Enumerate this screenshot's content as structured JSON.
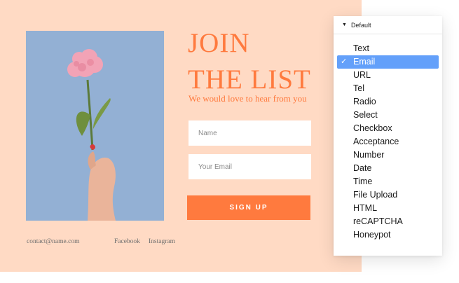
{
  "hero": {
    "title_line1": "JOIN",
    "title_line2": "THE LIST",
    "subtitle": "We would love to hear from you"
  },
  "form": {
    "name_placeholder": "Name",
    "email_placeholder": "Your Email",
    "signup_label": "SIGN UP"
  },
  "footer": {
    "contact": "contact@name.com",
    "facebook": "Facebook",
    "instagram": "Instagram"
  },
  "dropdown": {
    "header": "Default",
    "selected": "Email",
    "items": [
      "Text",
      "Email",
      "URL",
      "Tel",
      "Radio",
      "Select",
      "Checkbox",
      "Acceptance",
      "Number",
      "Date",
      "Time",
      "File Upload",
      "HTML",
      "reCAPTCHA",
      "Honeypot"
    ]
  },
  "colors": {
    "background": "#ffdac4",
    "accent": "#ff7a3e",
    "photo_background": "#93b0d4",
    "selection": "#63a0fa"
  },
  "icons": {
    "dropdown_caret": "caret-down-icon",
    "selected_mark": "checkmark-icon"
  }
}
